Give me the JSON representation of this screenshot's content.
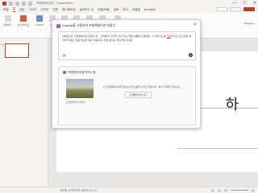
{
  "window": {
    "title": "프레젠테이션1 - PowerPoint",
    "controls": [
      "—",
      "☐",
      "✕"
    ]
  },
  "tabs": [
    "파일",
    "홈",
    "삽입",
    "그리기",
    "디자인",
    "전환",
    "애니메이션",
    "슬라이드 쇼",
    "녹음/녹화",
    "검토",
    "보기",
    "도움말",
    "Acrobat"
  ],
  "ribbon": {
    "groups": [
      {
        "label": "붙여넣기",
        "icon": "paste-icon"
      },
      {
        "label": "새 슬라이드",
        "icon": "new-slide-icon"
      },
      {
        "label": "Copilot",
        "icon": "copilot-icon"
      },
      {
        "label": "글꼴",
        "icon": "font-icon"
      },
      {
        "label": "단락",
        "icon": "paragraph-icon"
      },
      {
        "label": "그리기",
        "icon": "shapes-icon"
      },
      {
        "label": "편집",
        "icon": "edit-icon"
      },
      {
        "label": "받아쓰기",
        "icon": "dictate-icon"
      },
      {
        "label": "추가 기능",
        "icon": "addins-icon"
      }
    ],
    "designer_label": "Designer"
  },
  "slide_pane": {
    "slide_number": "1"
  },
  "slide": {
    "glyph": "하"
  },
  "statusbar": {
    "notes": "메모를 입력하려면 클릭하십시오"
  },
  "dialog": {
    "title": "Copilot을 사용하여 프레젠테이션 만들기",
    "prompt": {
      "text_before": "파워포인트 프레젠테이션 만들어 줘 · 고려해야 할 만한 것이 있는 전체 흐름을 포함해줘. 각 슬라이드에 ",
      "highlight": "내용",
      "text_after": "과 주요 포인트를 정리해 주세요. 발표 대상은 일반 청중이며, 전문 용어는 최소화해 주세요."
    },
    "result": {
      "title": "프레젠테이션을 만드는 중",
      "image_caption": "프레젠테이션 만들기",
      "description": "이 프레젠테이션을 만드는 데 도움을 드리고 있습니다. 잠시 기다려 주십시오.",
      "button": "프레젠테이션 보기"
    }
  }
}
